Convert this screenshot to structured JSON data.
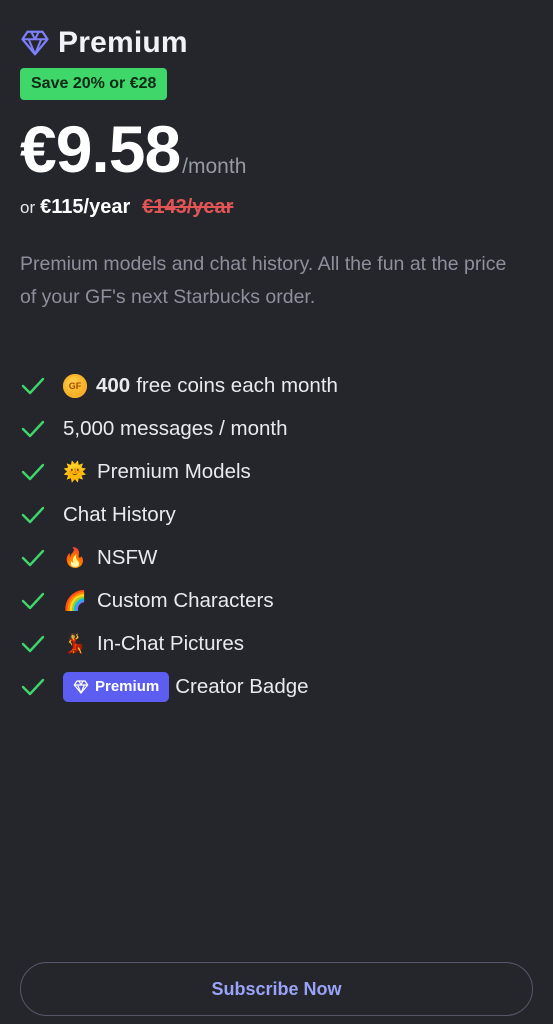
{
  "plan": {
    "title": "Premium",
    "save_badge": "Save 20% or €28",
    "price": "€9.58",
    "period": "/month",
    "or_text": "or",
    "yearly_price": "€115/year",
    "yearly_old_price": "€143/year",
    "description": "Premium models and chat history. All the fun at the price of your GF's next Starbucks order."
  },
  "features": [
    {
      "icon": "gf-coin-icon",
      "bold": "400",
      "label": "free coins each month"
    },
    {
      "icon": "",
      "label": "5,000 messages / month"
    },
    {
      "icon": "sun-emoji-icon",
      "emoji": "🌞",
      "label": "Premium Models"
    },
    {
      "icon": "",
      "label": "Chat History"
    },
    {
      "icon": "fire-emoji-icon",
      "emoji": "🔥",
      "label": "NSFW"
    },
    {
      "icon": "rainbow-emoji-icon",
      "emoji": "🌈",
      "label": "Custom Characters"
    },
    {
      "icon": "pose-emoji-icon",
      "emoji": "💃",
      "label": "In-Chat Pictures"
    },
    {
      "icon": "premium-pill",
      "pill": "Premium",
      "label": "Creator Badge"
    }
  ],
  "coin_text": "GF",
  "subscribe_label": "Subscribe Now",
  "colors": {
    "background": "#25262c",
    "accent": "#5b5ef0",
    "check": "#3fd66a",
    "strike": "#e25555",
    "save_badge": "#3fd66a"
  }
}
